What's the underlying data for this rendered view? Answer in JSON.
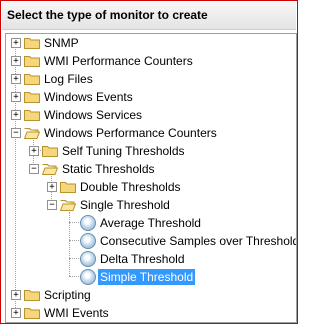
{
  "header": {
    "title": "Select the type of monitor to create"
  },
  "tree": {
    "items": [
      {
        "label": "SNMP",
        "expander": "+",
        "kind": "folder"
      },
      {
        "label": "WMI Performance Counters",
        "expander": "+",
        "kind": "folder"
      },
      {
        "label": "Log Files",
        "expander": "+",
        "kind": "folder"
      },
      {
        "label": "Windows Events",
        "expander": "+",
        "kind": "folder"
      },
      {
        "label": "Windows Services",
        "expander": "+",
        "kind": "folder"
      },
      {
        "label": "Windows Performance Counters",
        "expander": "−",
        "kind": "folder-open"
      },
      {
        "label": "Self Tuning Thresholds",
        "expander": "+",
        "kind": "folder"
      },
      {
        "label": "Static Thresholds",
        "expander": "−",
        "kind": "folder-open"
      },
      {
        "label": "Double Thresholds",
        "expander": "+",
        "kind": "folder"
      },
      {
        "label": "Single Threshold",
        "expander": "−",
        "kind": "folder-open"
      },
      {
        "label": "Average Threshold",
        "kind": "monitor"
      },
      {
        "label": "Consecutive Samples over Threshold",
        "kind": "monitor"
      },
      {
        "label": "Delta Threshold",
        "kind": "monitor"
      },
      {
        "label": "Simple Threshold",
        "kind": "monitor",
        "selected": true
      },
      {
        "label": "Scripting",
        "expander": "+",
        "kind": "folder"
      },
      {
        "label": "WMI Events",
        "expander": "+",
        "kind": "folder"
      }
    ]
  }
}
